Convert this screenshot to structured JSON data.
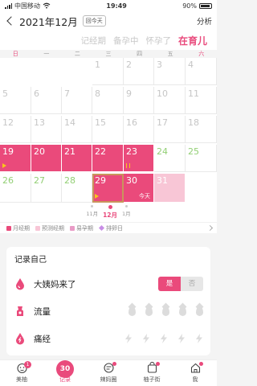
{
  "status_bar": {
    "carrier": "中国移动",
    "network": "",
    "time": "19:49",
    "battery": "90%",
    "battery_level": 0.9
  },
  "header": {
    "title": "2021年12月",
    "today_button": "回今天",
    "analysis": "分析"
  },
  "modes": [
    {
      "label": "记经期",
      "active": false
    },
    {
      "label": "备孕中",
      "active": false
    },
    {
      "label": "怀孕了",
      "active": false
    },
    {
      "label": "在育儿",
      "active": true
    }
  ],
  "weekdays": [
    "日",
    "一",
    "二",
    "三",
    "四",
    "五",
    "六"
  ],
  "calendar": {
    "days": [
      [
        "1",
        "2",
        "3",
        "4"
      ],
      [
        "5",
        "6",
        "7",
        "8",
        "9",
        "10",
        "11"
      ],
      [
        "12",
        "13",
        "14",
        "15",
        "16",
        "17",
        "18"
      ],
      [
        "19",
        "20",
        "21",
        "22",
        "23",
        "24",
        "25"
      ],
      [
        "26",
        "27",
        "28",
        "29",
        "30",
        "31"
      ]
    ],
    "today_label": "今天"
  },
  "month_nav": [
    {
      "label": "11月",
      "active": false
    },
    {
      "label": "12月",
      "active": true
    },
    {
      "label": "1月",
      "active": false
    }
  ],
  "legend": [
    {
      "label": "月经期",
      "color": "#ea4a7b",
      "shape": "square"
    },
    {
      "label": "预测经期",
      "color": "#f8c6d6",
      "shape": "square"
    },
    {
      "label": "易孕期",
      "color": "#e99bc6",
      "shape": "square"
    },
    {
      "label": "排卵日",
      "color": "#c88ee6",
      "shape": "diamond"
    }
  ],
  "record": {
    "title": "记录自己",
    "rows": [
      {
        "label": "大姨妈来了",
        "icon": "drop-icon",
        "yes": "是",
        "no": "否"
      },
      {
        "label": "流量",
        "icon": "pad-icon"
      },
      {
        "label": "痛经",
        "icon": "cramp-icon"
      }
    ]
  },
  "tabbar": [
    {
      "label": "美柚",
      "icon": "home-icon",
      "badge": "1",
      "active": false
    },
    {
      "label": "记录",
      "icon": "record-icon",
      "number": "30",
      "active": true
    },
    {
      "label": "辣妈圈",
      "icon": "community-icon",
      "active": false,
      "dot": true
    },
    {
      "label": "柚子街",
      "icon": "shop-icon",
      "active": false,
      "dot": true
    },
    {
      "label": "我",
      "icon": "profile-icon",
      "active": false,
      "dot": true
    }
  ],
  "colors": {
    "accent": "#e94a7c",
    "period": "#ea4a7b",
    "predicted": "#f8c6d6",
    "future": "#92cf74"
  }
}
